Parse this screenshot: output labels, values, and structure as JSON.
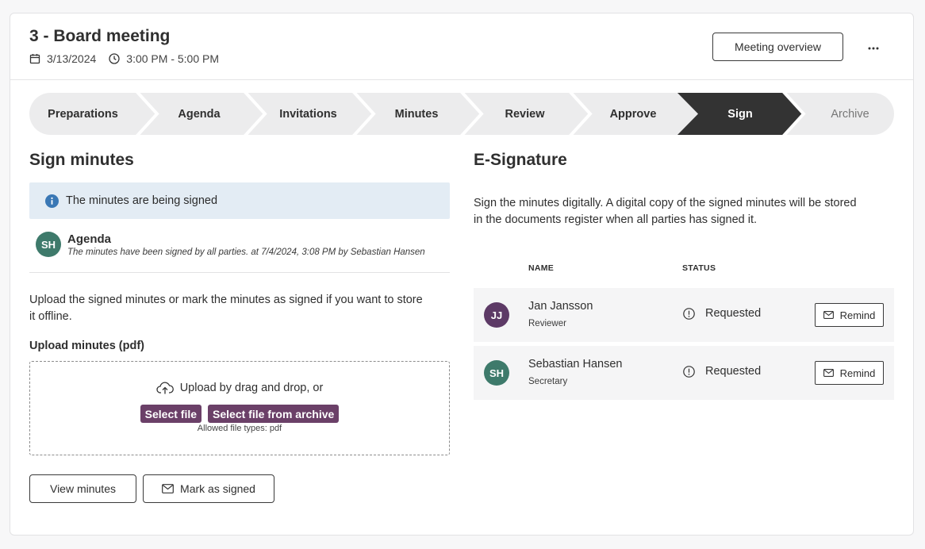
{
  "header": {
    "title": "3 - Board meeting",
    "date": "3/13/2024",
    "time": "3:00 PM - 5:00 PM",
    "overview_button": "Meeting overview",
    "more_icon": "more-horizontal-icon"
  },
  "stepper": {
    "steps": [
      {
        "label": "Preparations",
        "state": "done"
      },
      {
        "label": "Agenda",
        "state": "done"
      },
      {
        "label": "Invitations",
        "state": "done"
      },
      {
        "label": "Minutes",
        "state": "done"
      },
      {
        "label": "Review",
        "state": "done"
      },
      {
        "label": "Approve",
        "state": "done"
      },
      {
        "label": "Sign",
        "state": "active"
      },
      {
        "label": "Archive",
        "state": "future"
      }
    ],
    "active_color": "#333333",
    "bg_color": "#ececed"
  },
  "sign_minutes": {
    "heading": "Sign minutes",
    "info": "The minutes are being signed",
    "entry": {
      "initials": "SH",
      "avatar_color": "#3e7a6b",
      "title": "Agenda",
      "description": "The minutes have been signed by all parties. at 7/4/2024, 3:08 PM by Sebastian Hansen"
    },
    "upload_text_1": "Upload the signed minutes or mark the minutes as signed if you want to store",
    "upload_text_2": "it offline.",
    "upload_label": "Upload minutes (pdf)",
    "dropzone": {
      "text": "Upload by drag and drop, or",
      "select_file": "Select file",
      "select_archive": "Select file from archive",
      "hint": "Allowed file types: pdf"
    },
    "view_button": "View minutes",
    "mark_button": "Mark as signed"
  },
  "esignature": {
    "heading": "E-Signature",
    "description_1": "Sign the minutes digitally. A digital copy of the signed minutes will be stored",
    "description_2": "in the documents register when all parties has signed it.",
    "columns": {
      "name": "NAME",
      "status": "STATUS"
    },
    "signers": [
      {
        "initials": "JJ",
        "avatar_color": "#5d3a66",
        "name": "Jan Jansson",
        "role": "Reviewer",
        "status": "Requested",
        "action": "Remind"
      },
      {
        "initials": "SH",
        "avatar_color": "#3e7a6b",
        "name": "Sebastian Hansen",
        "role": "Secretary",
        "status": "Requested",
        "action": "Remind"
      }
    ]
  },
  "colors": {
    "accent": "#6b4068",
    "info_bg": "#e3ecf4",
    "info_icon": "#3a78b5"
  }
}
